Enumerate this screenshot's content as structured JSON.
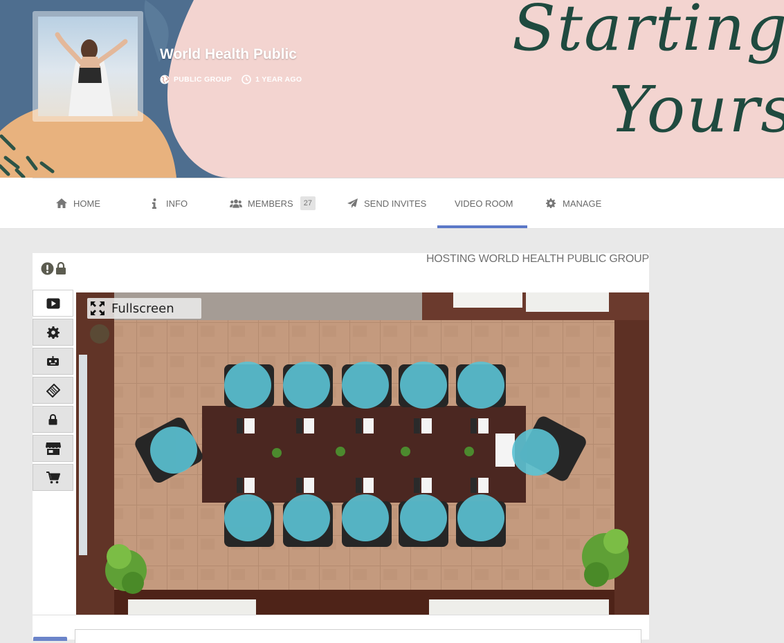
{
  "cover": {
    "text_line1": "Starting",
    "text_line2": "Yourse"
  },
  "group": {
    "title": "World Health Public",
    "type": "PUBLIC GROUP",
    "age": "1 YEAR AGO"
  },
  "nav": {
    "items": [
      {
        "label": "HOME",
        "icon": "home-icon"
      },
      {
        "label": "INFO",
        "icon": "info-icon"
      },
      {
        "label": "MEMBERS",
        "icon": "users-icon",
        "badge": "27"
      },
      {
        "label": "SEND INVITES",
        "icon": "paper-plane-icon"
      },
      {
        "label": "VIDEO ROOM",
        "active": true
      },
      {
        "label": "MANAGE",
        "icon": "gear-icon"
      }
    ],
    "active_color": "#5b78c7"
  },
  "room": {
    "hosting_text": "HOSTING WORLD HEALTH PUBLIC GROUP",
    "fullscreen_label": "Fullscreen",
    "seat_color": "#5bc3d4",
    "tools": [
      "play-icon",
      "gear-icon",
      "robot-icon",
      "ticket-icon",
      "lock-icon",
      "store-icon",
      "cart-icon"
    ]
  }
}
